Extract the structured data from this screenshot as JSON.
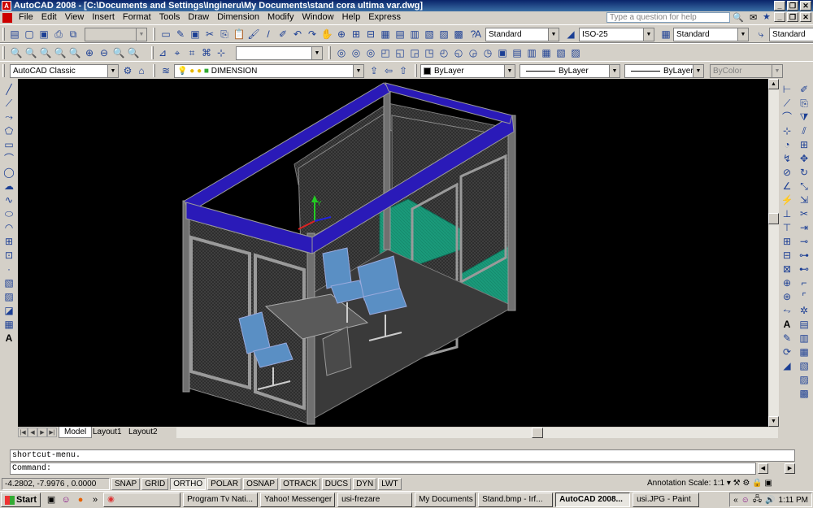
{
  "window": {
    "title": "AutoCAD 2008 - [C:\\Documents and Settings\\Ingineru\\My Documents\\stand cora ultima var.dwg]",
    "app_icon_letter": "A"
  },
  "menu": {
    "items": [
      "File",
      "Edit",
      "View",
      "Insert",
      "Format",
      "Tools",
      "Draw",
      "Dimension",
      "Modify",
      "Window",
      "Help",
      "Express"
    ],
    "help_placeholder": "Type a question for help"
  },
  "toolbar1": {
    "text_style": "Standard",
    "dim_style": "ISO-25",
    "table_style": "Standard",
    "multileader_style": "Standard"
  },
  "toolbar3": {
    "workspace": "AutoCAD Classic",
    "layer": "DIMENSION",
    "color": "ByLayer",
    "linetype": "ByLayer",
    "lineweight": "ByLayer",
    "plot_style": "ByColor"
  },
  "layout_tabs": [
    "Model",
    "Layout1",
    "Layout2"
  ],
  "command": {
    "history": "shortcut-menu.",
    "prompt": "Command:"
  },
  "status": {
    "coords": "-4.2802, -7.9976 , 0.0000",
    "toggles": [
      "SNAP",
      "GRID",
      "ORTHO",
      "POLAR",
      "OSNAP",
      "OTRACK",
      "DUCS",
      "DYN",
      "LWT"
    ],
    "ortho_on": "ORTHO",
    "annotation_scale_label": "Annotation Scale:",
    "annotation_scale_value": "1:1"
  },
  "taskbar": {
    "start": "Start",
    "items": [
      "Program Tv Nati...",
      "Yahoo! Messenger",
      "usi-frezare",
      "My Documents",
      "Stand.bmp - Irf...",
      "AutoCAD 2008...",
      "usi.JPG - Paint"
    ],
    "active": "AutoCAD 2008...",
    "clock": "1:11 PM"
  },
  "colors": {
    "title_bar": "#0a246a",
    "drawing_bg": "#000000",
    "frame_blue": "#2a1ab8",
    "panel_green": "#1a9a7a",
    "frame_gray": "#6e6e6e"
  }
}
